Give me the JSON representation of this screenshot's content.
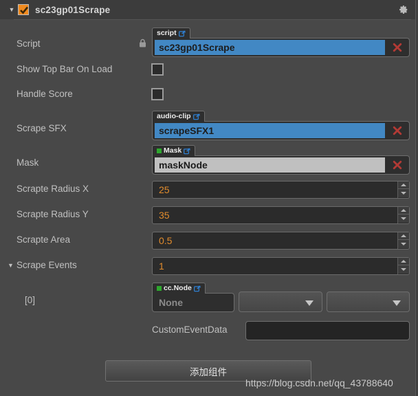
{
  "header": {
    "collapse_icon": "triangle-down-icon",
    "enabled_checkbox": "checked",
    "title": "sc23gp01Scrape",
    "gear_icon": "gear-icon"
  },
  "properties": [
    {
      "label": "Script",
      "kind": "asset",
      "lock": true,
      "tab": {
        "text": "script",
        "dot": false,
        "link_icon": "external-link-icon"
      },
      "value": "sc23gp01Scrape",
      "value_style": "blue",
      "clear_icon": "close-x-icon"
    },
    {
      "label": "Show Top Bar On Load",
      "kind": "checkbox",
      "checked": false
    },
    {
      "label": "Handle Score",
      "kind": "checkbox",
      "checked": false
    },
    {
      "label": "Scrape SFX",
      "kind": "asset",
      "lock": false,
      "tab": {
        "text": "audio-clip",
        "dot": false,
        "link_icon": "external-link-icon"
      },
      "value": "scrapeSFX1",
      "value_style": "blue",
      "clear_icon": "close-x-icon"
    },
    {
      "label": "Mask",
      "kind": "asset",
      "lock": false,
      "tab": {
        "text": "Mask",
        "dot": true,
        "link_icon": "external-link-icon"
      },
      "value": "maskNode",
      "value_style": "gray",
      "clear_icon": "close-x-icon"
    },
    {
      "label": "Scrapte Radius X",
      "kind": "number",
      "value": "25"
    },
    {
      "label": "Scrapte Radius Y",
      "kind": "number",
      "value": "35"
    },
    {
      "label": "Scrapte Area",
      "kind": "number",
      "value": "0.5"
    },
    {
      "label": "Scrape Events",
      "kind": "number",
      "value": "1",
      "foldout": true,
      "foldout_icon": "triangle-down-icon"
    }
  ],
  "event_entry": {
    "index_label": "[0]",
    "node": {
      "tab": {
        "text": "cc.Node",
        "dot": true,
        "link_icon": "external-link-icon"
      },
      "value": "None",
      "value_style": "none"
    },
    "component_dropdown": {
      "value": "",
      "chevron_icon": "chevron-down-icon"
    },
    "handler_dropdown": {
      "value": "",
      "chevron_icon": "chevron-down-icon"
    },
    "custom_event_data": {
      "label": "CustomEventData",
      "value": ""
    }
  },
  "footer": {
    "add_component_label": "添加组件"
  },
  "watermark": {
    "text": "https://blog.csdn.net/qq_43788640"
  },
  "colors": {
    "panel_bg": "#484848",
    "header_bg": "#3c3c3c",
    "accent_orange": "#f08a1e",
    "value_blue": "#4288c4",
    "value_gray": "#c0c0c0",
    "number_orange": "#e08b2c",
    "link_blue": "#2f7fd0",
    "node_green": "#2ea82e",
    "clear_red": "#b33a35"
  }
}
